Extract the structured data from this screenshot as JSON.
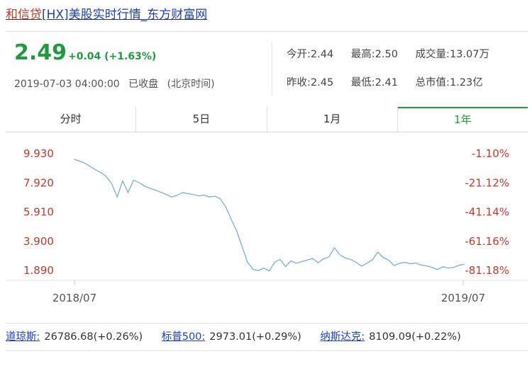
{
  "header": {
    "title_prefix": "和信贷",
    "title_rest": "[HX]美股实时行情_东方财富网"
  },
  "quote": {
    "price": "2.49",
    "change": "+0.04 (+1.63%)",
    "datetime": "2019-07-03 04:00:00",
    "status": "已收盘",
    "timezone": "(北京时间)",
    "stats": [
      [
        "今开:2.44",
        "最高:2.50",
        "成交量:13.07万"
      ],
      [
        "昨收:2.45",
        "最低:2.41",
        "总市值:1.23亿"
      ]
    ],
    "color_up": "#1f9a3e"
  },
  "tabs": [
    {
      "label": "分时",
      "active": false
    },
    {
      "label": "5日",
      "active": false
    },
    {
      "label": "1月",
      "active": false
    },
    {
      "label": "1年",
      "active": true
    }
  ],
  "chart_data": {
    "type": "line",
    "yticks_left": [
      "9.930",
      "7.920",
      "5.910",
      "3.900",
      "1.890"
    ],
    "yticks_right": [
      "-1.10%",
      "-21.12%",
      "-41.14%",
      "-61.16%",
      "-81.18%"
    ],
    "ylim": [
      1.89,
      9.93
    ],
    "xticks": [
      "2018/07",
      "2019/07"
    ],
    "line_color": "#6fa8dc",
    "axis_label_color": "#c0392b",
    "series": [
      {
        "values": [
          9.55,
          9.42,
          9.28,
          9.05,
          8.82,
          8.62,
          8.35,
          7.85,
          6.95,
          8.05,
          7.25,
          8.1,
          7.95,
          7.7,
          7.55,
          7.42,
          7.28,
          7.12,
          6.95,
          7.05,
          7.25,
          7.18,
          7.12,
          7.02,
          7.08,
          6.95,
          7.0,
          6.82,
          6.25,
          5.42,
          4.62,
          3.55,
          2.45,
          1.98,
          1.88,
          2.05,
          1.85,
          2.45,
          2.65,
          2.15,
          2.55,
          2.38,
          2.5,
          2.6,
          2.72,
          2.42,
          2.68,
          2.82,
          3.45,
          2.98,
          2.75,
          2.65,
          2.45,
          2.18,
          2.38,
          2.62,
          3.15,
          2.78,
          2.6,
          2.22,
          2.38,
          2.45,
          2.35,
          2.4,
          2.25,
          2.2,
          2.1,
          1.95,
          2.15,
          2.05,
          2.1,
          2.25,
          2.32
        ]
      }
    ]
  },
  "indices": [
    {
      "name": "道琼斯:",
      "value": "26786.68(+0.26%)"
    },
    {
      "name": "标普500:",
      "value": "2973.01(+0.29%)"
    },
    {
      "name": "纳斯达克:",
      "value": "8109.09(+0.22%)"
    }
  ]
}
